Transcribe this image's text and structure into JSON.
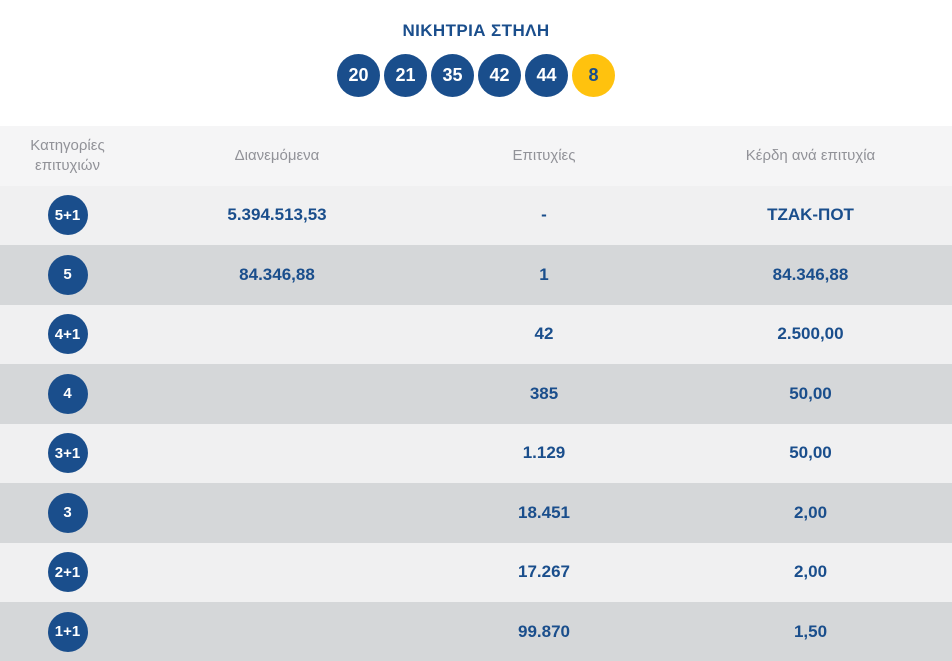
{
  "winning_column": {
    "title": "ΝΙΚΗΤΡΙΑ ΣΤΗΛΗ",
    "numbers": [
      "20",
      "21",
      "35",
      "42",
      "44"
    ],
    "joker": "8"
  },
  "table": {
    "headers": {
      "category": "Κατηγορίες επιτυχιών",
      "distributed": "Διανεμόμενα",
      "winners": "Επιτυχίες",
      "prize": "Κέρδη ανά επιτυχία"
    },
    "rows": [
      {
        "category": "5+1",
        "distributed": "5.394.513,53",
        "winners": "-",
        "prize": "ΤΖΑΚ-ΠΟΤ"
      },
      {
        "category": "5",
        "distributed": "84.346,88",
        "winners": "1",
        "prize": "84.346,88"
      },
      {
        "category": "4+1",
        "distributed": "",
        "winners": "42",
        "prize": "2.500,00"
      },
      {
        "category": "4",
        "distributed": "",
        "winners": "385",
        "prize": "50,00"
      },
      {
        "category": "3+1",
        "distributed": "",
        "winners": "1.129",
        "prize": "50,00"
      },
      {
        "category": "3",
        "distributed": "",
        "winners": "18.451",
        "prize": "2,00"
      },
      {
        "category": "2+1",
        "distributed": "",
        "winners": "17.267",
        "prize": "2,00"
      },
      {
        "category": "1+1",
        "distributed": "",
        "winners": "99.870",
        "prize": "1,50"
      }
    ]
  },
  "colors": {
    "brand_blue": "#1a4e8c",
    "joker_yellow": "#ffc20e",
    "header_bg": "#f5f5f6",
    "row_light": "#f0f0f1",
    "row_dark": "#d5d7d9",
    "header_text": "#919298"
  }
}
